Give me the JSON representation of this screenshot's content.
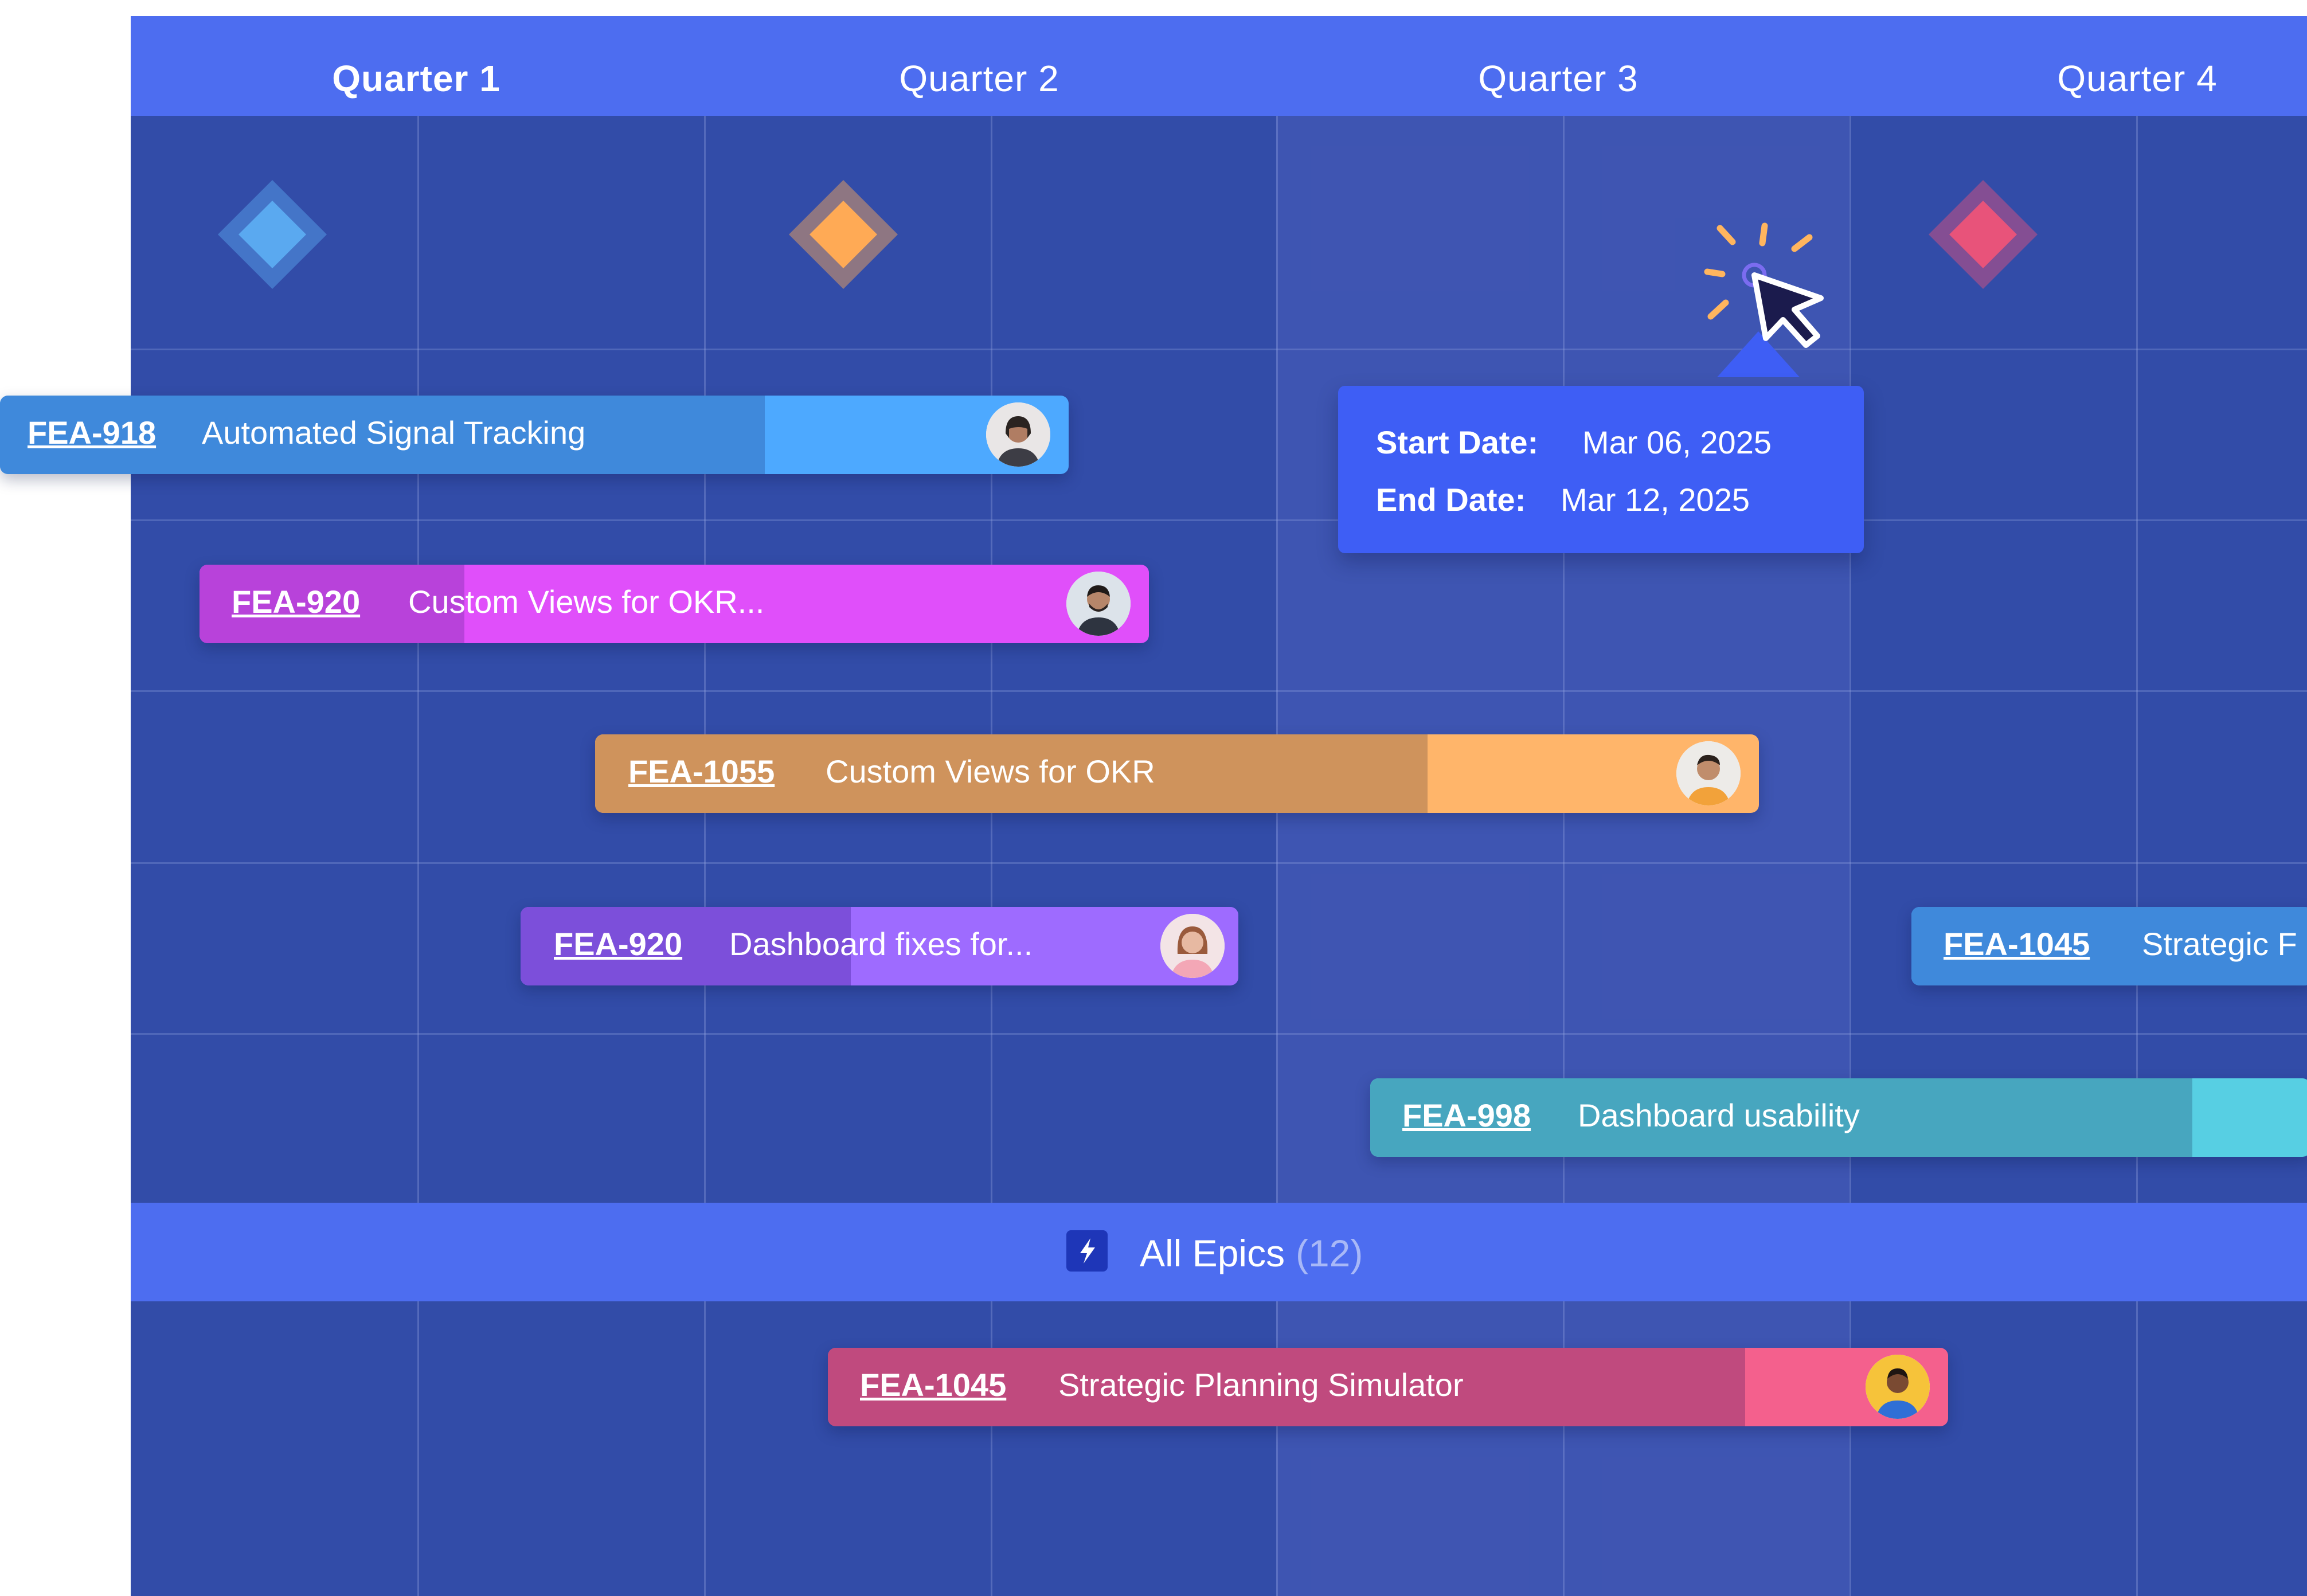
{
  "quarters": [
    "Quarter 1",
    "Quarter 2",
    "Quarter 3",
    "Quarter 4"
  ],
  "active_quarter": "Quarter 1",
  "milestones": [
    {
      "name": "milestone-blue",
      "color": "#5AA9F0"
    },
    {
      "name": "milestone-orange",
      "color": "#FFAA55"
    },
    {
      "name": "milestone-pink",
      "color": "#E8537A"
    }
  ],
  "features": [
    {
      "key": "FEA-918",
      "title": "Automated Signal Tracking",
      "color": "#3F89DB",
      "light_color": "#4DA9FF",
      "progress": 0.71,
      "assignee": "woman with dark hair"
    },
    {
      "key": "FEA-920",
      "title": "Custom Views for OKR...",
      "color": "#B842DA",
      "light_color": "#E04FFA",
      "progress": 0.28,
      "assignee": "man with beard"
    },
    {
      "key": "FEA-1055",
      "title": "Custom Views for OKR",
      "color": "#CF935C",
      "light_color": "#FFB56A",
      "progress": 0.72,
      "assignee": "man in orange shirt"
    },
    {
      "key": "FEA-920",
      "title": "Dashboard fixes for...",
      "color": "#7C4FDA",
      "light_color": "#9E6BFF",
      "progress": 0.46,
      "assignee": "woman smiling"
    },
    {
      "key": "FEA-1045",
      "title": "Strategic F",
      "color": "#3F89DB",
      "light_color": "#4DA9FF",
      "progress": 1.0,
      "assignee": ""
    },
    {
      "key": "FEA-998",
      "title": "Dashboard usability",
      "color": "#47A6BF",
      "light_color": "#57CFE3",
      "progress": 0.86,
      "assignee": ""
    }
  ],
  "tooltip": {
    "start_label": "Start Date:",
    "start_value": "Mar 06, 2025",
    "end_label": "End Date:",
    "end_value": "Mar 12, 2025"
  },
  "epics": {
    "label": "All Epics",
    "count": "(12)",
    "icon": "lightning-icon"
  },
  "epic_features": [
    {
      "key": "FEA-1045",
      "title": "Strategic Planning Simulator",
      "color": "#C04A7E",
      "light_color": "#F4608D",
      "progress": 0.82,
      "assignee": "man in yellow shirt"
    }
  ],
  "cursor": {
    "icon": "click-cursor-icon",
    "spark_color": "#FFB55E"
  }
}
